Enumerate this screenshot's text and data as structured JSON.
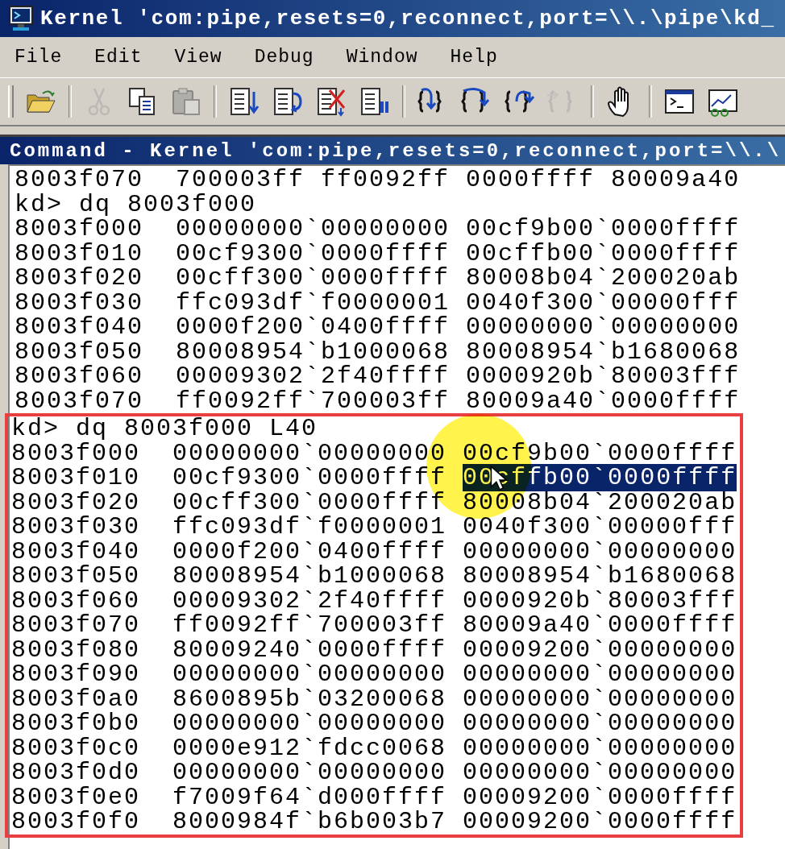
{
  "window": {
    "title": "Kernel 'com:pipe,resets=0,reconnect,port=\\\\.\\pipe\\kd_"
  },
  "menu": [
    {
      "label": "File"
    },
    {
      "label": "Edit"
    },
    {
      "label": "View"
    },
    {
      "label": "Debug"
    },
    {
      "label": "Window"
    },
    {
      "label": "Help"
    }
  ],
  "toolbar": [
    {
      "kind": "open",
      "disabled": false
    },
    {
      "kind": "separator"
    },
    {
      "kind": "cut",
      "disabled": true
    },
    {
      "kind": "copy",
      "disabled": false
    },
    {
      "kind": "paste",
      "disabled": true
    },
    {
      "kind": "separator"
    },
    {
      "kind": "doc-down",
      "disabled": false
    },
    {
      "kind": "doc-loop",
      "disabled": false
    },
    {
      "kind": "doc-cross",
      "disabled": false
    },
    {
      "kind": "doc-pause",
      "disabled": false
    },
    {
      "kind": "separator"
    },
    {
      "kind": "step-into",
      "disabled": false
    },
    {
      "kind": "step-over",
      "disabled": false
    },
    {
      "kind": "step-out",
      "disabled": false
    },
    {
      "kind": "run-to",
      "disabled": true
    },
    {
      "kind": "separator"
    },
    {
      "kind": "hand",
      "disabled": false
    },
    {
      "kind": "separator"
    },
    {
      "kind": "console",
      "disabled": false
    },
    {
      "kind": "chart",
      "disabled": false
    }
  ],
  "command_window": {
    "title": "Command - Kernel 'com:pipe,resets=0,reconnect,port=\\\\.\\",
    "lines": [
      {
        "text": "8003f070  700003ff ff0092ff 0000ffff 80009a40"
      },
      {
        "text": "kd> dq 8003f000"
      },
      {
        "text": "8003f000  00000000`00000000 00cf9b00`0000ffff"
      },
      {
        "text": "8003f010  00cf9300`0000ffff 00cffb00`0000ffff"
      },
      {
        "text": "8003f020  00cff300`0000ffff 80008b04`200020ab"
      },
      {
        "text": "8003f030  ffc093df`f0000001 0040f300`00000fff"
      },
      {
        "text": "8003f040  0000f200`0400ffff 00000000`00000000"
      },
      {
        "text": "8003f050  80008954`b1000068 80008954`b1680068"
      },
      {
        "text": "8003f060  00009302`2f40ffff 0000920b`80003fff"
      },
      {
        "text": "8003f070  ff0092ff`700003ff 80009a40`0000ffff"
      }
    ],
    "highlighted_block": {
      "lines": [
        {
          "text": "kd> dq 8003f000 L40"
        },
        {
          "text": "8003f000  00000000`00000000 00cf9b00`0000ffff"
        },
        {
          "text": "8003f010  00cf9300`0000ffff ",
          "selected_text": "00cffb00`0000ffff",
          "pointer": true
        },
        {
          "text": "8003f020  00cff300`0000ffff 80008b04`200020ab"
        },
        {
          "text": "8003f030  ffc093df`f0000001 0040f300`00000fff"
        },
        {
          "text": "8003f040  0000f200`0400ffff 00000000`00000000"
        },
        {
          "text": "8003f050  80008954`b1000068 80008954`b1680068"
        },
        {
          "text": "8003f060  00009302`2f40ffff 0000920b`80003fff"
        },
        {
          "text": "8003f070  ff0092ff`700003ff 80009a40`0000ffff"
        },
        {
          "text": "8003f080  80009240`0000ffff 00009200`00000000"
        },
        {
          "text": "8003f090  00000000`00000000 00000000`00000000"
        },
        {
          "text": "8003f0a0  8600895b`03200068 00000000`00000000"
        },
        {
          "text": "8003f0b0  00000000`00000000 00000000`00000000"
        },
        {
          "text": "8003f0c0  0000e912`fdcc0068 00000000`00000000"
        },
        {
          "text": "8003f0d0  00000000`00000000 00000000`00000000"
        },
        {
          "text": "8003f0e0  f7009f64`d000ffff 00009200`0000ffff"
        },
        {
          "text": "8003f0f0  8000984f`b6b003b7 00009200`0000ffff"
        }
      ]
    }
  }
}
